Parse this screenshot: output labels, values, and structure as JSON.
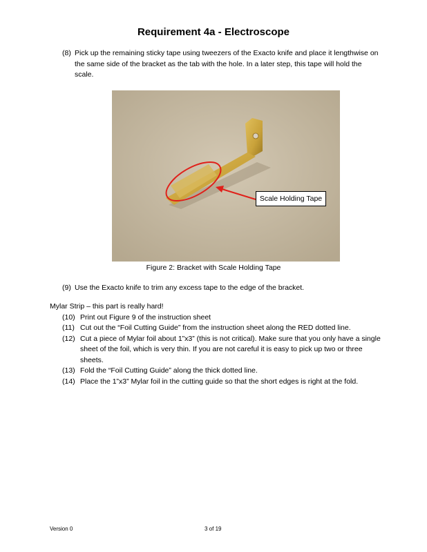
{
  "page": {
    "title": "Requirement 4a - Electroscope",
    "step8": {
      "number": "(8)",
      "line1": "Pick up the remaining sticky tape using tweezers of the Exacto knife and place it lengthwise on",
      "line2": "the same side of the bracket as the tab with the hole.  In a later step, this tape will hold the",
      "line3": "scale."
    },
    "figure": {
      "callout": "Scale Holding Tape",
      "caption": "Figure 2: Bracket with Scale Holding Tape",
      "colors": {
        "background": "#c7bba5",
        "brass": "#c9a23a",
        "ellipse": "#e0201a"
      }
    },
    "step9": {
      "number": "(9)",
      "text": "Use the Exacto knife to trim any excess tape to the edge of the bracket."
    },
    "mylar": {
      "heading": "Mylar Strip – this part is really hard!",
      "steps": [
        {
          "number": "(10)",
          "lines": [
            "Print out Figure 9 of the instruction sheet"
          ]
        },
        {
          "number": "(11)",
          "lines": [
            "Cut out the “Foil Cutting Guide” from the instruction sheet along the RED dotted line."
          ]
        },
        {
          "number": "(12)",
          "lines": [
            "Cut a piece of Mylar foil about 1”x3” (this is not critical).  Make sure that you only have a single",
            "sheet of the foil, which is very thin.  If you are not careful it is easy to pick up two or three",
            "sheets."
          ]
        },
        {
          "number": "(13)",
          "lines": [
            "Fold the “Foil Cutting Guide” along the thick dotted line."
          ]
        },
        {
          "number": "(14)",
          "lines": [
            "Place the 1”x3” Mylar foil in the cutting guide so that the short edges is right at the fold."
          ]
        }
      ]
    },
    "footer": {
      "version": "Version 0",
      "page_of": "3 of 19"
    }
  }
}
